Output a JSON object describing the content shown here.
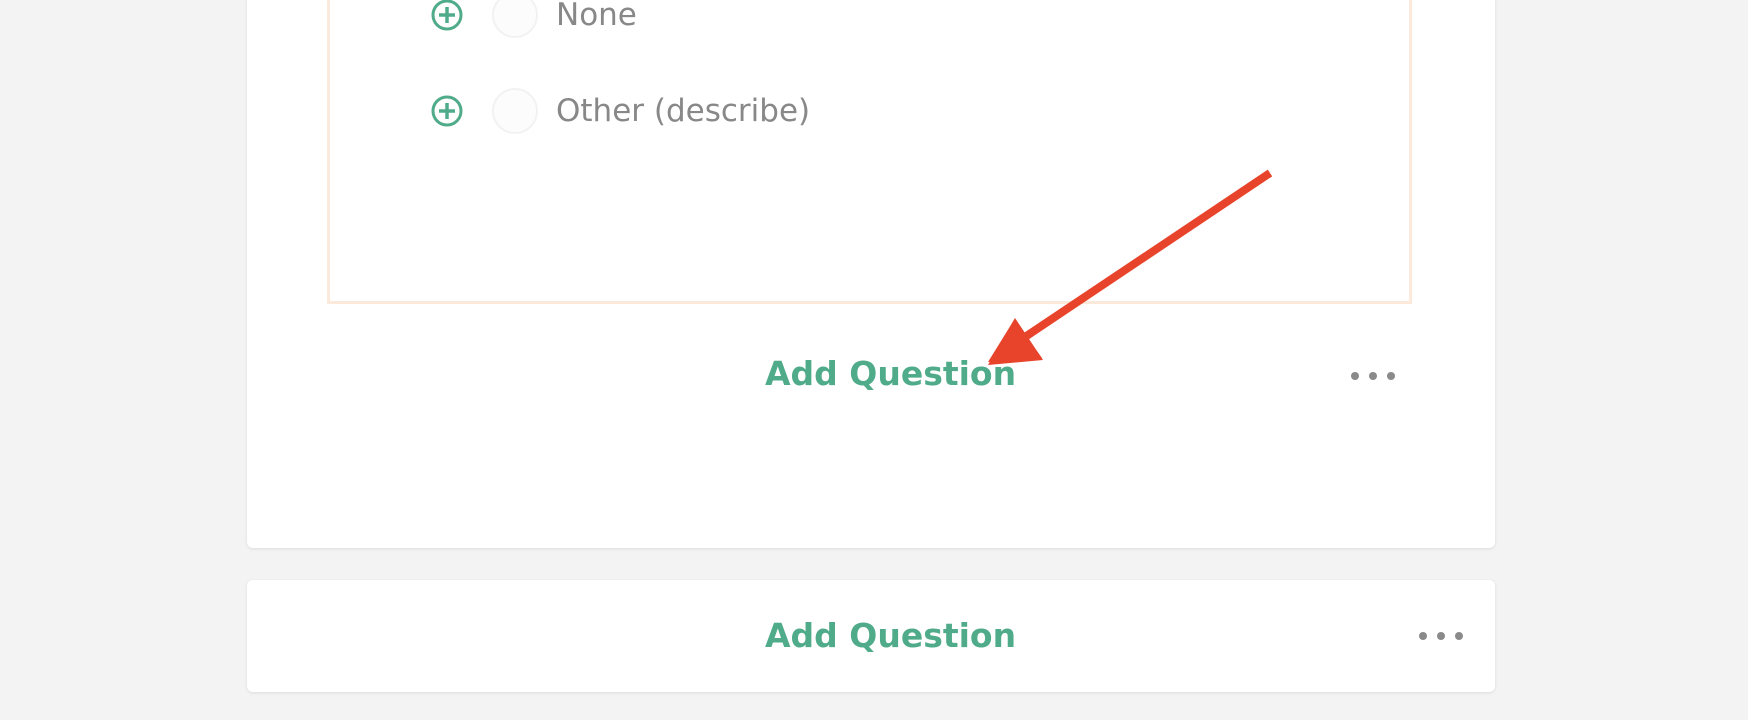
{
  "question_block": {
    "options": [
      {
        "label": "None",
        "icon": "plus-circle-icon"
      },
      {
        "label": "Other (describe)",
        "icon": "plus-circle-icon"
      }
    ]
  },
  "main_card": {
    "add_question_label": "Add Question",
    "more_icon": "ellipsis-icon"
  },
  "second_card": {
    "add_question_label": "Add Question",
    "more_icon": "ellipsis-icon"
  },
  "colors": {
    "accent_green": "#4fab8a",
    "annotation_arrow": "#e8442c",
    "question_border": "#fbeadb",
    "background": "#f3f3f3"
  }
}
